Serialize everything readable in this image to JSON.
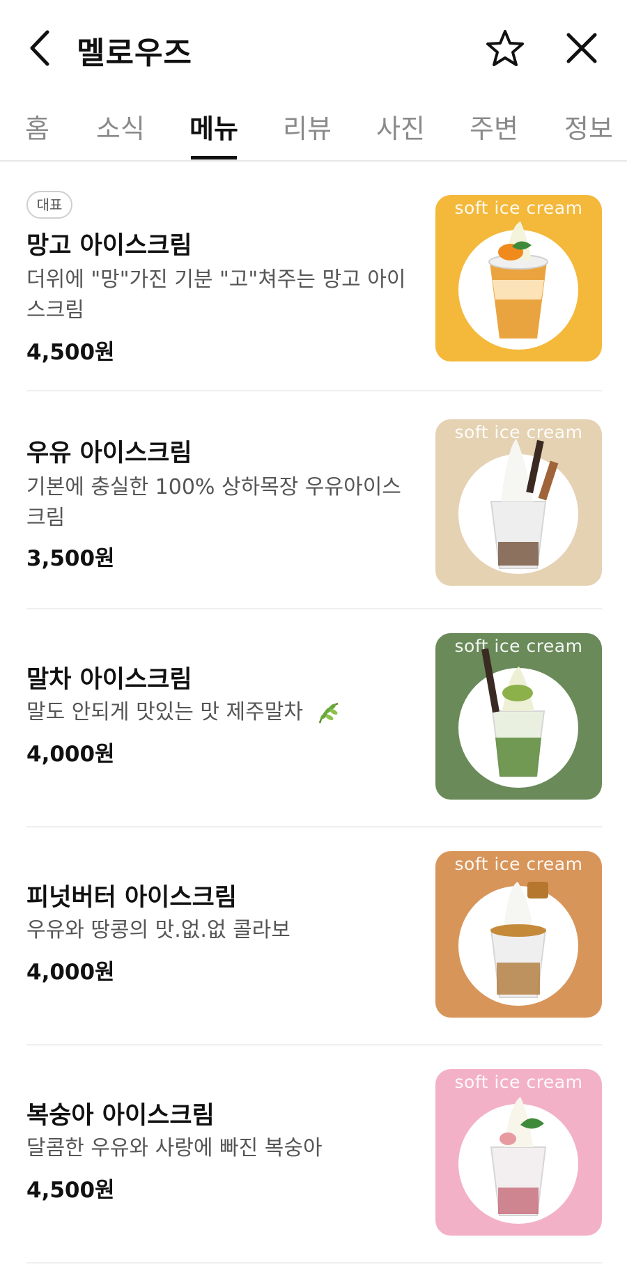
{
  "header": {
    "title": "멜로우즈",
    "back_icon": "chevron-left-icon",
    "favorite_icon": "star-outline-icon",
    "close_icon": "close-icon"
  },
  "tabs": [
    {
      "label": "홈"
    },
    {
      "label": "소식"
    },
    {
      "label": "메뉴",
      "active": true
    },
    {
      "label": "리뷰"
    },
    {
      "label": "사진"
    },
    {
      "label": "주변"
    },
    {
      "label": "정보"
    }
  ],
  "menu": {
    "items": [
      {
        "badge": "대표",
        "name": "망고 아이스크림",
        "desc": "더위에 \"망\"가진 기분 \"고\"쳐주는 망고 아이스크림",
        "price": "4,500원",
        "thumb_label": "soft ice cream",
        "thumb_color": "#f4b83a",
        "cone_color": "#e89a2a"
      },
      {
        "name": "우유 아이스크림",
        "desc": "기본에 충실한 100% 상하목장 우유아이스크림",
        "price": "3,500원",
        "thumb_label": "soft ice cream",
        "thumb_color": "#e5d2b3",
        "cone_color": "#7a5a44"
      },
      {
        "name": "말차 아이스크림",
        "desc": "말도 안되게 맛있는 맛 제주말차",
        "desc_icon": "leaf-emoji-icon",
        "price": "4,000원",
        "thumb_label": "soft ice cream",
        "thumb_color": "#6a8a5a",
        "cone_color": "#5c8a3a"
      },
      {
        "name": "피넛버터 아이스크림",
        "desc": "우유와 땅콩의 맛.없.없 콜라보",
        "price": "4,000원",
        "thumb_label": "soft ice cream",
        "thumb_color": "#d8955a",
        "cone_color": "#b07a3a"
      },
      {
        "name": "복숭아 아이스크림",
        "desc": "달콤한 우유와 사랑에 빠진 복숭아",
        "price": "4,500원",
        "thumb_label": "soft ice cream",
        "thumb_color": "#f3b1c8",
        "cone_color": "#c46a78"
      }
    ]
  }
}
